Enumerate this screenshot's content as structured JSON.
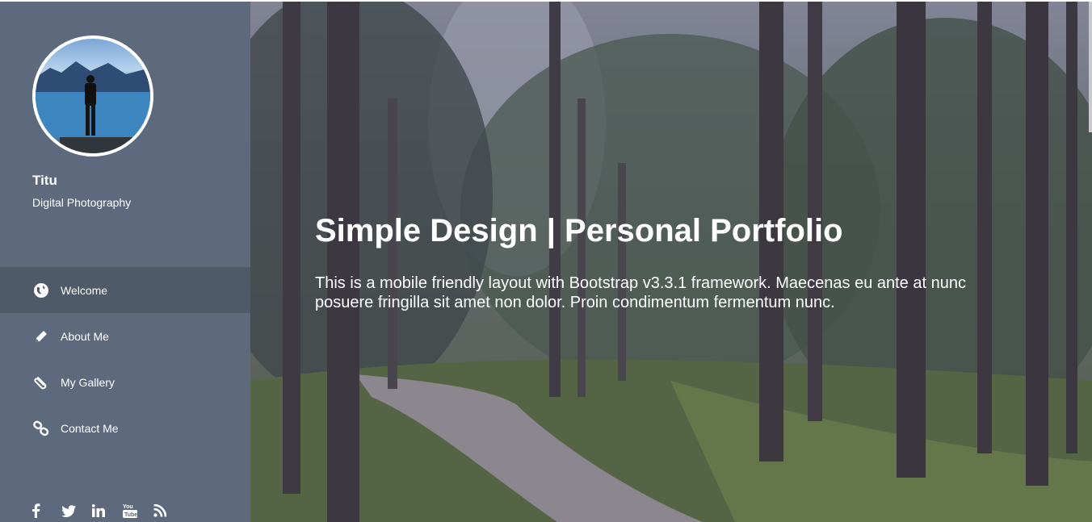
{
  "profile": {
    "name": "Titu",
    "role": "Digital Photography"
  },
  "nav": {
    "items": [
      {
        "label": "Welcome",
        "icon": "globe-icon",
        "active": true
      },
      {
        "label": "About Me",
        "icon": "pencil-icon",
        "active": false
      },
      {
        "label": "My Gallery",
        "icon": "paperclip-icon",
        "active": false
      },
      {
        "label": "Contact Me",
        "icon": "link-icon",
        "active": false
      }
    ]
  },
  "social": [
    "facebook-icon",
    "twitter-icon",
    "linkedin-icon",
    "youtube-icon",
    "rss-icon"
  ],
  "hero": {
    "title": "Simple Design | Personal Portfolio",
    "text": "This is a mobile friendly layout with Bootstrap v3.3.1 framework. Maecenas eu ante at nunc posuere fringilla sit amet non dolor. Proin condimentum fermentum nunc."
  },
  "colors": {
    "sidebar": "#5d6a7e",
    "nav_active": "#4f5a69",
    "text": "#ffffff"
  }
}
